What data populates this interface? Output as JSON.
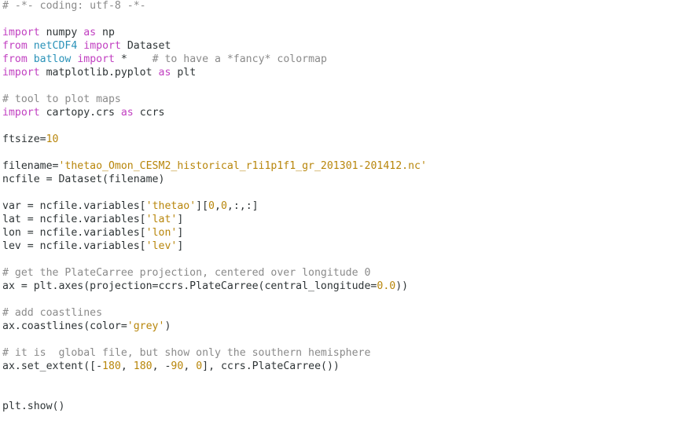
{
  "editor": {
    "background": "#ffffff",
    "colors": {
      "plain": "#2e3436",
      "comment": "#8a8a8a",
      "keyword": "#c13fc1",
      "module": "#2a92b8",
      "string": "#b8860b",
      "number": "#b8860b"
    },
    "lines": [
      [
        {
          "t": "# -*- coding: utf-8 -*-",
          "c": "comment"
        }
      ],
      [],
      [
        {
          "t": "import",
          "c": "keyword"
        },
        {
          "t": " numpy ",
          "c": "plain"
        },
        {
          "t": "as",
          "c": "keyword"
        },
        {
          "t": " np",
          "c": "plain"
        }
      ],
      [
        {
          "t": "from",
          "c": "keyword"
        },
        {
          "t": " ",
          "c": "plain"
        },
        {
          "t": "netCDF4",
          "c": "module"
        },
        {
          "t": " ",
          "c": "plain"
        },
        {
          "t": "import",
          "c": "keyword"
        },
        {
          "t": " Dataset",
          "c": "plain"
        }
      ],
      [
        {
          "t": "from",
          "c": "keyword"
        },
        {
          "t": " ",
          "c": "plain"
        },
        {
          "t": "batlow",
          "c": "module"
        },
        {
          "t": " ",
          "c": "plain"
        },
        {
          "t": "import",
          "c": "keyword"
        },
        {
          "t": " *    ",
          "c": "plain"
        },
        {
          "t": "# to have a *fancy* colormap",
          "c": "comment"
        }
      ],
      [
        {
          "t": "import",
          "c": "keyword"
        },
        {
          "t": " matplotlib.pyplot ",
          "c": "plain"
        },
        {
          "t": "as",
          "c": "keyword"
        },
        {
          "t": " plt",
          "c": "plain"
        }
      ],
      [],
      [
        {
          "t": "# tool to plot maps",
          "c": "comment"
        }
      ],
      [
        {
          "t": "import",
          "c": "keyword"
        },
        {
          "t": " cartopy.crs ",
          "c": "plain"
        },
        {
          "t": "as",
          "c": "keyword"
        },
        {
          "t": " ccrs",
          "c": "plain"
        }
      ],
      [],
      [
        {
          "t": "ftsize=",
          "c": "plain"
        },
        {
          "t": "10",
          "c": "number"
        }
      ],
      [],
      [
        {
          "t": "filename=",
          "c": "plain"
        },
        {
          "t": "'thetao_Omon_CESM2_historical_r1i1p1f1_gr_201301-201412.nc'",
          "c": "string"
        }
      ],
      [
        {
          "t": "ncfile = Dataset(filename)",
          "c": "plain"
        }
      ],
      [],
      [
        {
          "t": "var = ncfile.variables[",
          "c": "plain"
        },
        {
          "t": "'thetao'",
          "c": "string"
        },
        {
          "t": "][",
          "c": "plain"
        },
        {
          "t": "0",
          "c": "number"
        },
        {
          "t": ",",
          "c": "plain"
        },
        {
          "t": "0",
          "c": "number"
        },
        {
          "t": ",:,:]",
          "c": "plain"
        }
      ],
      [
        {
          "t": "lat = ncfile.variables[",
          "c": "plain"
        },
        {
          "t": "'lat'",
          "c": "string"
        },
        {
          "t": "]",
          "c": "plain"
        }
      ],
      [
        {
          "t": "lon = ncfile.variables[",
          "c": "plain"
        },
        {
          "t": "'lon'",
          "c": "string"
        },
        {
          "t": "]",
          "c": "plain"
        }
      ],
      [
        {
          "t": "lev = ncfile.variables[",
          "c": "plain"
        },
        {
          "t": "'lev'",
          "c": "string"
        },
        {
          "t": "]",
          "c": "plain"
        }
      ],
      [],
      [
        {
          "t": "# get the PlateCarree projection, centered over longitude 0",
          "c": "comment"
        }
      ],
      [
        {
          "t": "ax = plt.axes(projection=ccrs.PlateCarree(central_longitude=",
          "c": "plain"
        },
        {
          "t": "0.0",
          "c": "number"
        },
        {
          "t": "))",
          "c": "plain"
        }
      ],
      [],
      [
        {
          "t": "# add coastlines",
          "c": "comment"
        }
      ],
      [
        {
          "t": "ax.coastlines(color=",
          "c": "plain"
        },
        {
          "t": "'grey'",
          "c": "string"
        },
        {
          "t": ")",
          "c": "plain"
        }
      ],
      [],
      [
        {
          "t": "# it is  global file, but show only the southern hemisphere",
          "c": "comment"
        }
      ],
      [
        {
          "t": "ax.set_extent([-",
          "c": "plain"
        },
        {
          "t": "180",
          "c": "number"
        },
        {
          "t": ", ",
          "c": "plain"
        },
        {
          "t": "180",
          "c": "number"
        },
        {
          "t": ", -",
          "c": "plain"
        },
        {
          "t": "90",
          "c": "number"
        },
        {
          "t": ", ",
          "c": "plain"
        },
        {
          "t": "0",
          "c": "number"
        },
        {
          "t": "], ccrs.PlateCarree())",
          "c": "plain"
        }
      ],
      [],
      [],
      [
        {
          "t": "plt.show()",
          "c": "plain"
        }
      ]
    ]
  }
}
